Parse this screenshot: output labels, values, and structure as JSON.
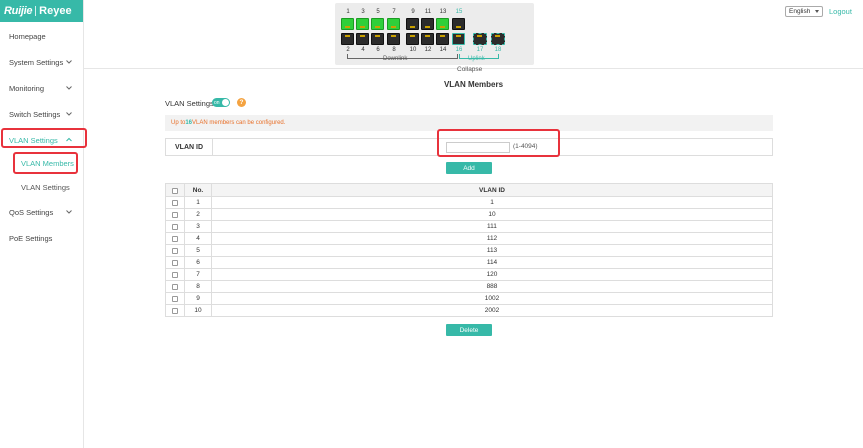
{
  "brand": {
    "left": "Ruijie",
    "right": "Reyee"
  },
  "menu": {
    "homepage": "Homepage",
    "system_settings": "System Settings",
    "monitoring": "Monitoring",
    "switch_settings": "Switch Settings",
    "vlan_settings": "VLAN Settings",
    "vlan_members": "VLAN Members",
    "vlan_settings_sub": "VLAN Settings",
    "qos_settings": "QoS Settings",
    "poe_settings": "PoE Settings"
  },
  "panel": {
    "top_ports": [
      "1",
      "3",
      "5",
      "7",
      "9",
      "11",
      "13",
      "15"
    ],
    "bottom_ports": [
      "2",
      "4",
      "6",
      "8",
      "10",
      "12",
      "14",
      "16",
      "17",
      "18"
    ],
    "top_states": [
      "green",
      "green",
      "green",
      "green",
      "dark",
      "dark",
      "green",
      "dark"
    ],
    "bottom_states": [
      "dark",
      "dark",
      "dark",
      "dark",
      "dark",
      "dark",
      "dark",
      "dark"
    ],
    "downlink_label": "Downlink",
    "uplink_label": "Uplink",
    "collapse_label": "Collapse"
  },
  "header": {
    "language": "English",
    "logout": "Logout"
  },
  "page": {
    "title": "VLAN Members",
    "vlan_settings_label": "VLAN Settings",
    "toggle_text": "on",
    "help_glyph": "?",
    "notice_prefix": "Up to ",
    "notice_count": "16",
    "notice_suffix": " VLAN members can be configured.",
    "vlan_id_label": "VLAN ID",
    "vlan_id_value": "",
    "vlan_id_hint": "(1-4094)",
    "add_button": "Add",
    "delete_button": "Delete"
  },
  "table": {
    "headers": {
      "no": "No.",
      "vlan_id": "VLAN ID"
    },
    "rows": [
      {
        "no": "1",
        "vlan_id": "1"
      },
      {
        "no": "2",
        "vlan_id": "10"
      },
      {
        "no": "3",
        "vlan_id": "111"
      },
      {
        "no": "4",
        "vlan_id": "112"
      },
      {
        "no": "5",
        "vlan_id": "113"
      },
      {
        "no": "6",
        "vlan_id": "114"
      },
      {
        "no": "7",
        "vlan_id": "120"
      },
      {
        "no": "8",
        "vlan_id": "888"
      },
      {
        "no": "9",
        "vlan_id": "1002"
      },
      {
        "no": "10",
        "vlan_id": "2002"
      }
    ]
  },
  "colors": {
    "accent": "#37b9a8",
    "highlight": "#e8323c",
    "notice": "#e8702a",
    "port_active": "#2fcf3a"
  }
}
